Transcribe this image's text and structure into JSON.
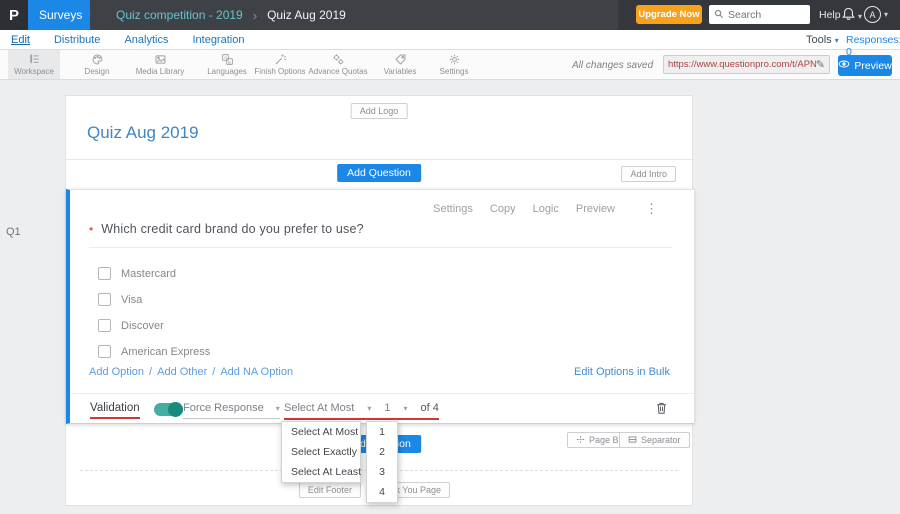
{
  "icons": {
    "caret_down": "▾",
    "breadcrumb_separator": "›",
    "ellipsis_vertical": "⋮",
    "pencil": "✎",
    "required_marker": "•",
    "link_separator": "/"
  },
  "topbar": {
    "logo": "P",
    "surveys_label": "Surveys",
    "breadcrumb_parent": "Quiz competition - 2019",
    "breadcrumb_current": "Quiz Aug 2019",
    "upgrade_label": "Upgrade Now",
    "search_placeholder": "Search",
    "help_label": "Help",
    "avatar_initial": "A"
  },
  "nav": {
    "items": [
      {
        "label": "Edit"
      },
      {
        "label": "Distribute"
      },
      {
        "label": "Analytics"
      },
      {
        "label": "Integration"
      }
    ],
    "tools_label": "Tools",
    "responses_label": "Responses: 0"
  },
  "toolbar": {
    "items": [
      {
        "label": "Workspace"
      },
      {
        "label": "Design"
      },
      {
        "label": "Media Library"
      },
      {
        "label": "Languages"
      },
      {
        "label": "Finish Options"
      },
      {
        "label": "Advance Quotas"
      },
      {
        "label": "Variables"
      },
      {
        "label": "Settings"
      }
    ],
    "status": "All changes saved",
    "url": "https://www.questionpro.com/t/APNrFZ",
    "preview_label": "Preview"
  },
  "survey": {
    "add_logo_label": "Add Logo",
    "title": "Quiz Aug 2019",
    "add_question_label": "Add Question",
    "add_intro_label": "Add Intro",
    "page_break_label": "Page Break",
    "separator_label": "Separator",
    "edit_footer_label": "Edit Footer",
    "thank_you_label": "Thank You Page"
  },
  "question": {
    "id": "Q1",
    "text": "Which credit card brand do you prefer to use?",
    "actions": [
      {
        "label": "Settings"
      },
      {
        "label": "Copy"
      },
      {
        "label": "Logic"
      },
      {
        "label": "Preview"
      }
    ],
    "options": [
      {
        "label": "Mastercard"
      },
      {
        "label": "Visa"
      },
      {
        "label": "Discover"
      },
      {
        "label": "American Express"
      }
    ],
    "add_links": [
      {
        "label": "Add Option"
      },
      {
        "label": "Add Other"
      },
      {
        "label": "Add NA Option"
      }
    ],
    "bulk_link": "Edit Options in Bulk",
    "validation": {
      "label": "Validation",
      "force_response_label": "Force Response",
      "rule_value": "Select At Most",
      "count_value": "1",
      "of_label": "of 4"
    }
  },
  "dropdowns": {
    "rules": [
      {
        "label": "Select At Most"
      },
      {
        "label": "Select Exactly"
      },
      {
        "label": "Select At Least"
      }
    ],
    "counts": [
      {
        "label": "1"
      },
      {
        "label": "2"
      },
      {
        "label": "3"
      },
      {
        "label": "4"
      }
    ]
  },
  "colors": {
    "accent_blue": "#1b87e6",
    "upgrade_orange": "#f9a11b",
    "toggle_teal": "#45aca1",
    "underline_red": "#cc3b33",
    "title_blue": "#3e86c7",
    "topbar_dark": "#34383c"
  }
}
